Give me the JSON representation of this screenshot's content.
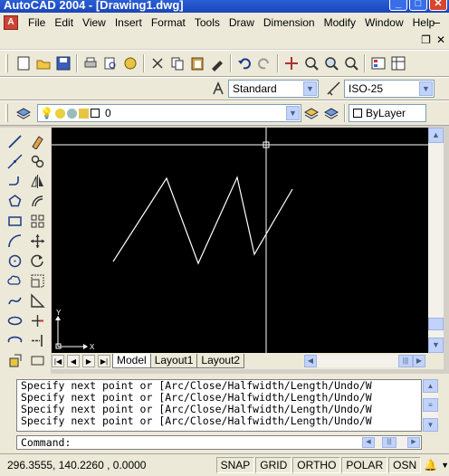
{
  "window": {
    "title": "AutoCAD 2004 - [Drawing1.dwg]",
    "app_icon": "autocad-logo-icon",
    "controls": [
      "minimize-icon",
      "maximize-icon",
      "close-icon"
    ]
  },
  "menu": {
    "items": [
      {
        "label": "File"
      },
      {
        "label": "Edit"
      },
      {
        "label": "View"
      },
      {
        "label": "Insert"
      },
      {
        "label": "Format"
      },
      {
        "label": "Tools"
      },
      {
        "label": "Draw"
      },
      {
        "label": "Dimension"
      },
      {
        "label": "Modify"
      },
      {
        "label": "Window"
      },
      {
        "label": "Help"
      }
    ],
    "doc_minimize": "–",
    "doc_restore": "❐",
    "doc_close": "✕"
  },
  "styles_toolbar": {
    "text_style": "Standard",
    "dim_style": "ISO-25"
  },
  "layers_toolbar": {
    "layer_name": "0",
    "color": "ByLayer"
  },
  "layout_tabs": {
    "tabs": [
      "Model",
      "Layout1",
      "Layout2"
    ],
    "active": "Model"
  },
  "ucs": {
    "x_label": "X",
    "y_label": "Y"
  },
  "command": {
    "history": [
      "Specify next point or [Arc/Close/Halfwidth/Length/Undo/W",
      "Specify next point or [Arc/Close/Halfwidth/Length/Undo/W",
      "Specify next point or [Arc/Close/Halfwidth/Length/Undo/W",
      "Specify next point or [Arc/Close/Halfwidth/Length/Undo/W"
    ],
    "prompt": "Command:"
  },
  "status": {
    "coordinates": "296.3555, 140.2260 , 0.0000",
    "toggles": [
      "SNAP",
      "GRID",
      "ORTHO",
      "POLAR",
      "OSN"
    ]
  },
  "colors": {
    "canvas_bg": "#000000",
    "polyline": "#ffffff",
    "title_bar": "#2a5fd6",
    "chrome": "#ece9d8"
  }
}
